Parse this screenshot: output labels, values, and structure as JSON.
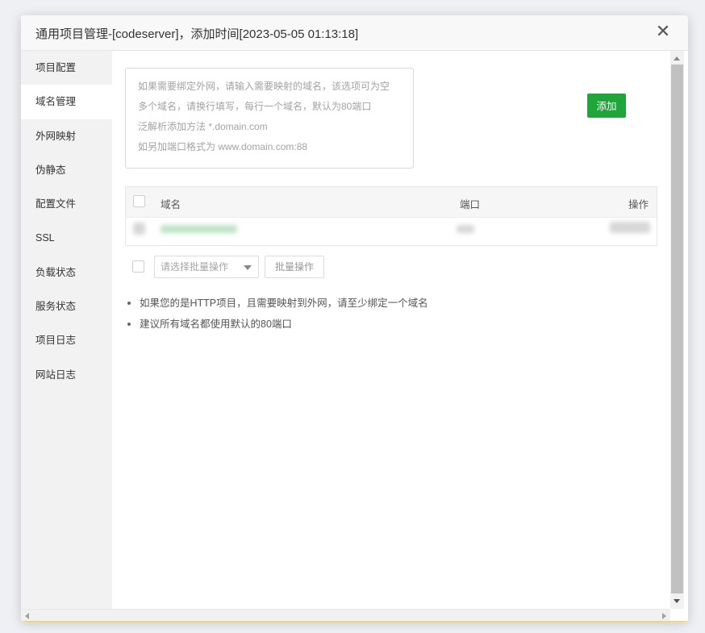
{
  "dialog": {
    "title": "通用项目管理-[codeserver]，添加时间[2023-05-05 01:13:18]",
    "close_glyph": "✕"
  },
  "sidebar": {
    "items": [
      {
        "label": "项目配置"
      },
      {
        "label": "域名管理",
        "active": true
      },
      {
        "label": "外网映射"
      },
      {
        "label": "伪静态"
      },
      {
        "label": "配置文件"
      },
      {
        "label": "SSL"
      },
      {
        "label": "负载状态"
      },
      {
        "label": "服务状态"
      },
      {
        "label": "项目日志"
      },
      {
        "label": "网站日志"
      }
    ]
  },
  "domain_form": {
    "placeholder_lines": [
      "如果需要绑定外网，请输入需要映射的域名，该选项可为空",
      "多个域名，请换行填写，每行一个域名，默认为80端口",
      "泛解析添加方法 *.domain.com",
      "如另加端口格式为 www.domain.com:88"
    ],
    "add_label": "添加"
  },
  "table": {
    "headers": {
      "domain": "域名",
      "port": "端口",
      "action": "操作"
    }
  },
  "batch": {
    "select_placeholder": "请选择批量操作",
    "button_label": "批量操作"
  },
  "tips": [
    "如果您的是HTTP项目，且需要映射到外网，请至少绑定一个域名",
    "建议所有域名都使用默认的80端口"
  ],
  "colors": {
    "accent": "#20a53a",
    "sidebar_bg": "#f2f2f2",
    "titlebar_bg": "#f8f8f8"
  }
}
